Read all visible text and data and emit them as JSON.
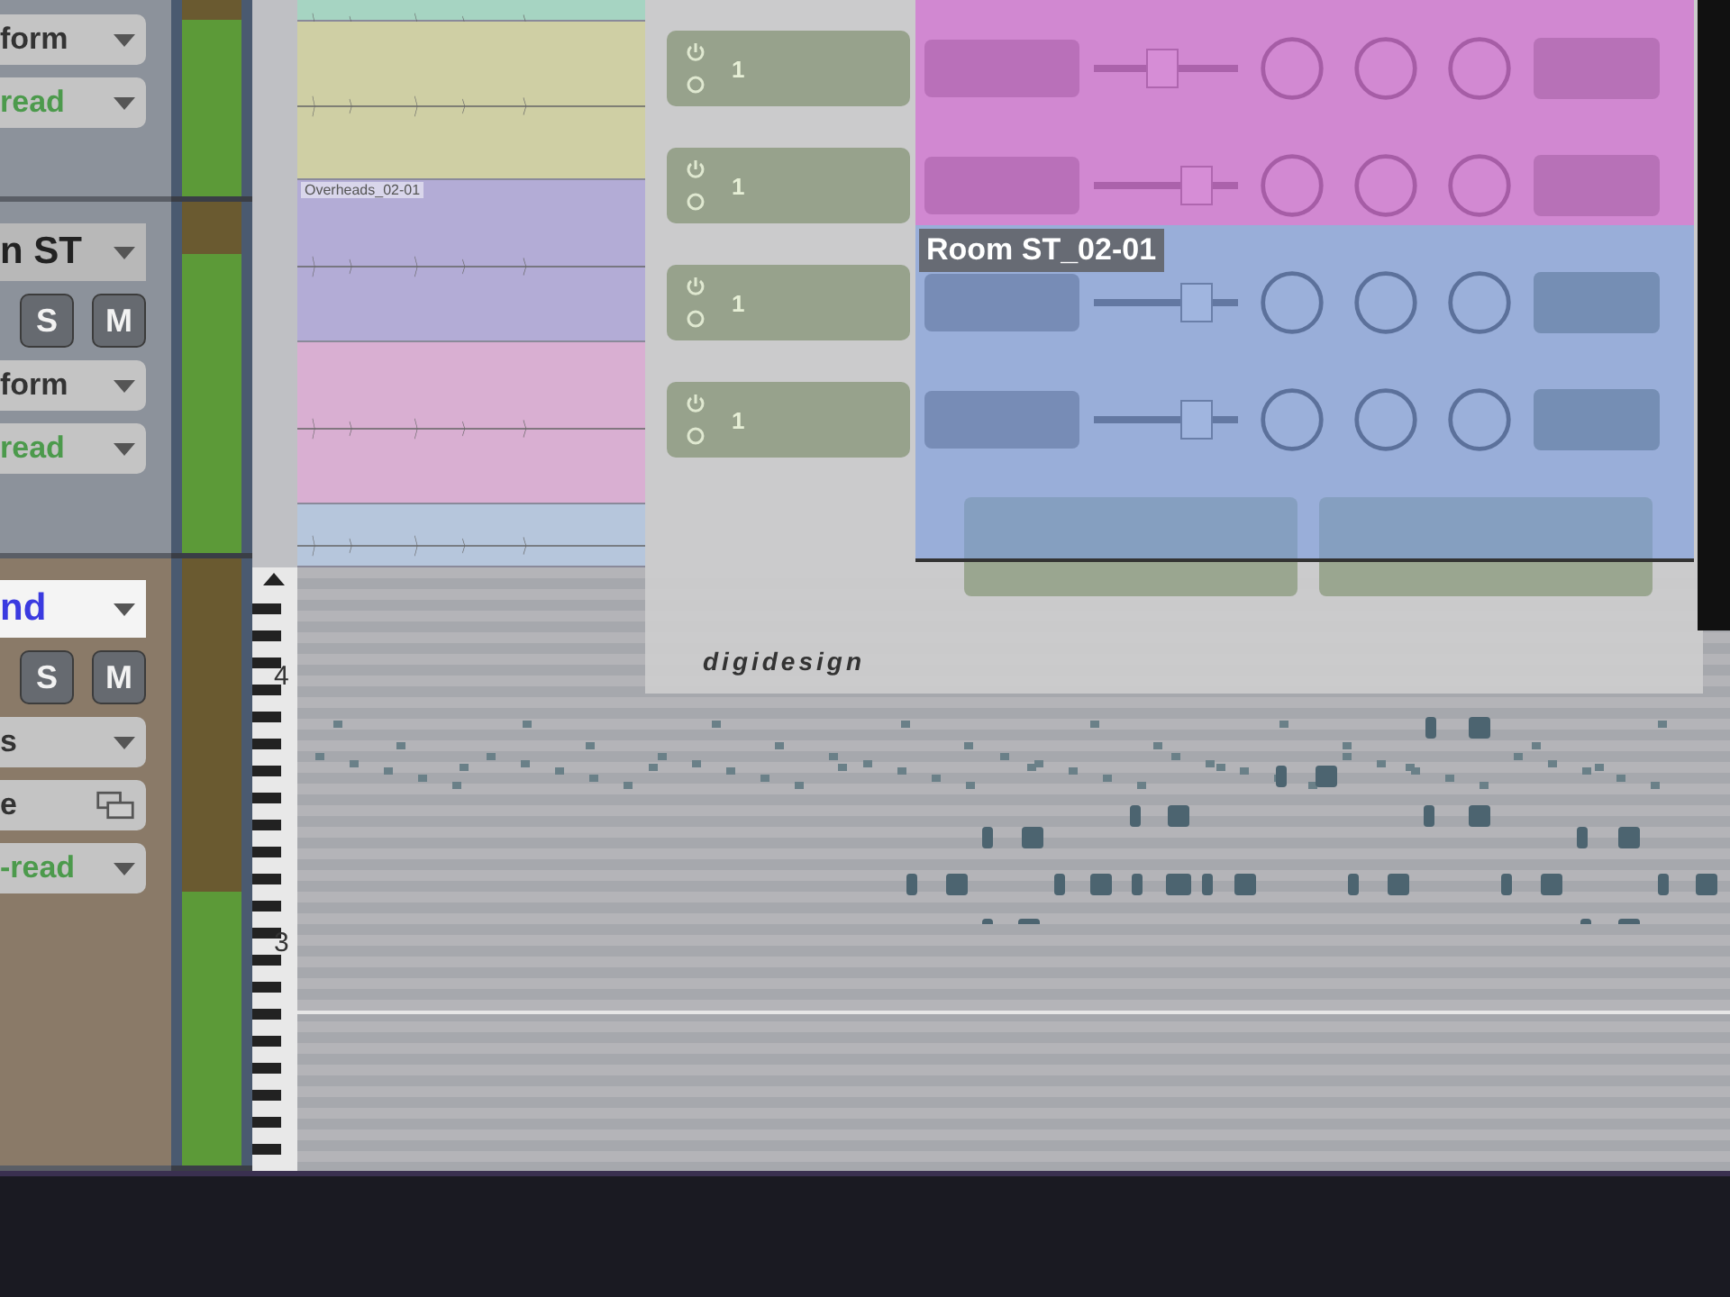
{
  "edit_window": {
    "track_headers": [
      {
        "level": 0.9,
        "items": [
          {
            "kind": "popup",
            "text": "form"
          },
          {
            "kind": "automation",
            "text": "read"
          }
        ]
      },
      {
        "level": 0.85,
        "items": [
          {
            "kind": "name",
            "text": "n ST"
          },
          {
            "kind": "solo_mute",
            "solo": "S",
            "mute": "M"
          },
          {
            "kind": "popup",
            "text": "form"
          },
          {
            "kind": "automation",
            "text": "read"
          }
        ]
      },
      {
        "level": 0.45,
        "items": [
          {
            "kind": "name_selected",
            "text": "nd"
          },
          {
            "kind": "solo_mute",
            "solo": "S",
            "mute": "M"
          },
          {
            "kind": "popup",
            "text": "s"
          },
          {
            "kind": "io",
            "text": "e"
          },
          {
            "kind": "automation",
            "text": "-read"
          }
        ]
      }
    ],
    "lanes": [
      {
        "color": "#a6d4c2"
      },
      {
        "color": "#cfcfa4"
      },
      {
        "color": "#b3acd6",
        "clip_name": "Overheads_02-01"
      },
      {
        "color": "#d9afd2"
      },
      {
        "color": "#b6c6dc"
      }
    ],
    "piano_roll": {
      "octave_labels": [
        "4",
        "3"
      ]
    }
  },
  "plugin": {
    "slots": [
      {
        "number": "1",
        "level": 0.45
      },
      {
        "number": "1",
        "level": 0.75
      },
      {
        "number": "1",
        "level": 0.75
      },
      {
        "number": "1",
        "level": 0.75
      }
    ],
    "logo": "digidesign"
  },
  "region_label": "Room ST_02-01"
}
